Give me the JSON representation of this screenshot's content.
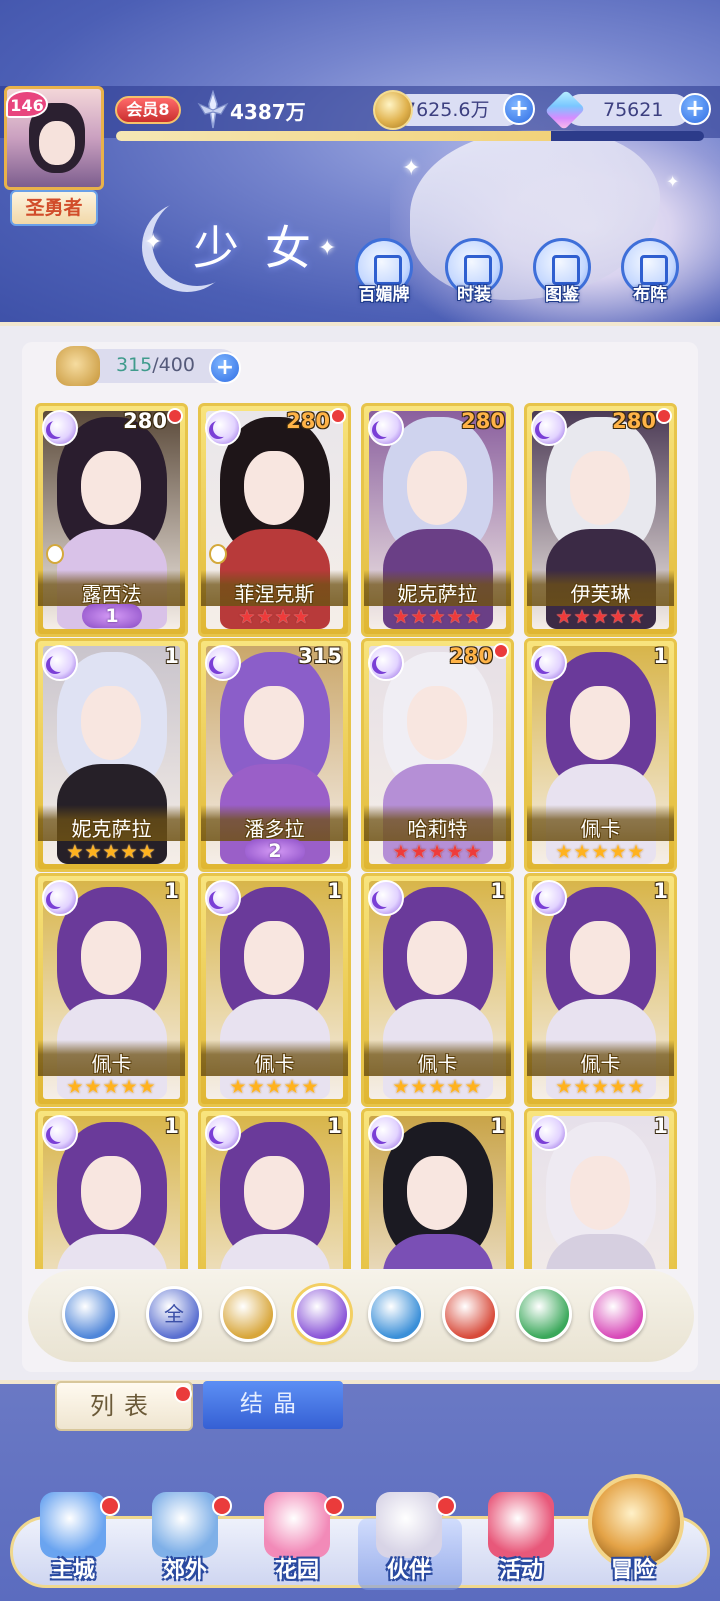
{
  "header": {
    "player_level": "146",
    "player_title": "圣勇者",
    "vip": "会员8",
    "power": "4387万",
    "gold": "7625.6万",
    "diamonds": "75621",
    "exp_progress": 0.74,
    "page_title": "少女",
    "menu": [
      {
        "label": "百媚牌",
        "icon": "card-deck-icon"
      },
      {
        "label": "时装",
        "icon": "outfit-icon"
      },
      {
        "label": "图鉴",
        "icon": "codex-book-icon"
      },
      {
        "label": "布阵",
        "icon": "formation-grid-icon"
      }
    ]
  },
  "inventory": {
    "current": "315",
    "max": "/400"
  },
  "cards": [
    {
      "name": "露西法",
      "level": "280",
      "level_color": "white",
      "dot": true,
      "stars": "",
      "star_color": "",
      "rank": "1",
      "chess": true,
      "hair": "#2a1d2e",
      "body": "#d9c2e8",
      "bg": "#5b4a3a"
    },
    {
      "name": "菲涅克斯",
      "level": "280",
      "level_color": "orange",
      "dot": true,
      "stars": "★★★★",
      "star_color": "red",
      "rank": "",
      "chess": true,
      "hair": "#1e1518",
      "body": "#b83a3a",
      "bg": "#e9e6ea"
    },
    {
      "name": "妮克萨拉",
      "level": "280",
      "level_color": "orange",
      "dot": false,
      "stars": "★★★★★",
      "star_color": "red",
      "rank": "",
      "chess": false,
      "hair": "#cfd3ee",
      "body": "#6a3f86",
      "bg": "#8a5f9e"
    },
    {
      "name": "伊芙琳",
      "level": "280",
      "level_color": "orange",
      "dot": true,
      "stars": "★★★★★",
      "star_color": "red",
      "rank": "",
      "chess": false,
      "hair": "#e8e8ee",
      "body": "#3b2a45",
      "bg": "#4b3a55"
    },
    {
      "name": "妮克萨拉",
      "level": "1",
      "level_color": "white",
      "dot": false,
      "stars": "★★★★★",
      "star_color": "gold",
      "rank": "",
      "chess": false,
      "hair": "#dfe2f3",
      "body": "#262028",
      "bg": "#c9c4cc"
    },
    {
      "name": "潘多拉",
      "level": "315",
      "level_color": "white",
      "dot": false,
      "stars": "",
      "star_color": "",
      "rank": "2",
      "chess": false,
      "hair": "#8b5ec9",
      "body": "#9a5fc8",
      "bg": "#caa76a"
    },
    {
      "name": "哈莉特",
      "level": "280",
      "level_color": "orange",
      "dot": true,
      "stars": "★★★★★",
      "star_color": "red",
      "rank": "",
      "chess": false,
      "hair": "#f0eef4",
      "body": "#b58fd6",
      "bg": "#e6dfe6"
    },
    {
      "name": "佩卡",
      "level": "1",
      "level_color": "white",
      "dot": false,
      "stars": "★★★★★",
      "star_color": "gold",
      "rank": "",
      "chess": false,
      "hair": "#6a3a9a",
      "body": "#e8e2f0",
      "bg": "#d8b54a"
    },
    {
      "name": "佩卡",
      "level": "1",
      "level_color": "white",
      "dot": false,
      "stars": "★★★★★",
      "star_color": "gold",
      "rank": "",
      "chess": false,
      "hair": "#6a3a9a",
      "body": "#e8e2f0",
      "bg": "#d8b54a"
    },
    {
      "name": "佩卡",
      "level": "1",
      "level_color": "white",
      "dot": false,
      "stars": "★★★★★",
      "star_color": "gold",
      "rank": "",
      "chess": false,
      "hair": "#6a3a9a",
      "body": "#e8e2f0",
      "bg": "#d8b54a"
    },
    {
      "name": "佩卡",
      "level": "1",
      "level_color": "white",
      "dot": false,
      "stars": "★★★★★",
      "star_color": "gold",
      "rank": "",
      "chess": false,
      "hair": "#6a3a9a",
      "body": "#e8e2f0",
      "bg": "#d8b54a"
    },
    {
      "name": "佩卡",
      "level": "1",
      "level_color": "white",
      "dot": false,
      "stars": "★★★★★",
      "star_color": "gold",
      "rank": "",
      "chess": false,
      "hair": "#6a3a9a",
      "body": "#e8e2f0",
      "bg": "#d8b54a"
    },
    {
      "name": "",
      "level": "1",
      "level_color": "white",
      "dot": false,
      "stars": "",
      "star_color": "",
      "rank": "",
      "chess": false,
      "hair": "#6a3a9a",
      "body": "#e8e2f0",
      "bg": "#d8b54a"
    },
    {
      "name": "",
      "level": "1",
      "level_color": "white",
      "dot": false,
      "stars": "",
      "star_color": "",
      "rank": "",
      "chess": false,
      "hair": "#6a3a9a",
      "body": "#e8e2f0",
      "bg": "#d8b54a"
    },
    {
      "name": "",
      "level": "1",
      "level_color": "white",
      "dot": false,
      "stars": "",
      "star_color": "",
      "rank": "",
      "chess": false,
      "hair": "#1b1a22",
      "body": "#7a4fb5",
      "bg": "#c9a448"
    },
    {
      "name": "",
      "level": "1",
      "level_color": "white",
      "dot": false,
      "stars": "",
      "star_color": "",
      "rank": "",
      "chess": false,
      "hair": "#eeeaf2",
      "body": "#d6cfe0",
      "bg": "#e6e0ea"
    }
  ],
  "filters": [
    {
      "icon": "wing-up-icon",
      "label": "",
      "color": "#4f86d9",
      "active": false
    },
    {
      "icon": "all-icon",
      "label": "全",
      "color": "#5a6fd0",
      "active": false
    },
    {
      "icon": "sun-icon",
      "label": "",
      "color": "#d8a63a",
      "active": false
    },
    {
      "icon": "moon-icon",
      "label": "",
      "color": "#8a55d8",
      "active": true
    },
    {
      "icon": "water-drop-icon",
      "label": "",
      "color": "#3a8fd8",
      "active": false
    },
    {
      "icon": "fire-icon",
      "label": "",
      "color": "#d84a3a",
      "active": false
    },
    {
      "icon": "wind-icon",
      "label": "",
      "color": "#3aa85a",
      "active": false
    },
    {
      "icon": "orbit-icon",
      "label": "",
      "color": "#d84ab8",
      "active": false
    }
  ],
  "tabs": {
    "list_label": "列表",
    "crystal_label": "结晶"
  },
  "nav": [
    {
      "label": "主城",
      "icon": "castle-icon",
      "color": "#6aa4f0",
      "dot": true,
      "active": false
    },
    {
      "label": "郊外",
      "icon": "portal-gate-icon",
      "color": "#7fb0e8",
      "dot": true,
      "active": false
    },
    {
      "label": "花园",
      "icon": "heart-garden-icon",
      "color": "#f28ab8",
      "dot": true,
      "active": false
    },
    {
      "label": "伙伴",
      "icon": "partner-portrait-icon",
      "color": "#d8d4e6",
      "dot": true,
      "active": true
    },
    {
      "label": "活动",
      "icon": "gift-box-icon",
      "color": "#e8587a",
      "dot": false,
      "active": false
    },
    {
      "label": "冒险",
      "icon": "adventure-compass-icon",
      "color": "#e4a347",
      "dot": false,
      "active": false
    }
  ]
}
